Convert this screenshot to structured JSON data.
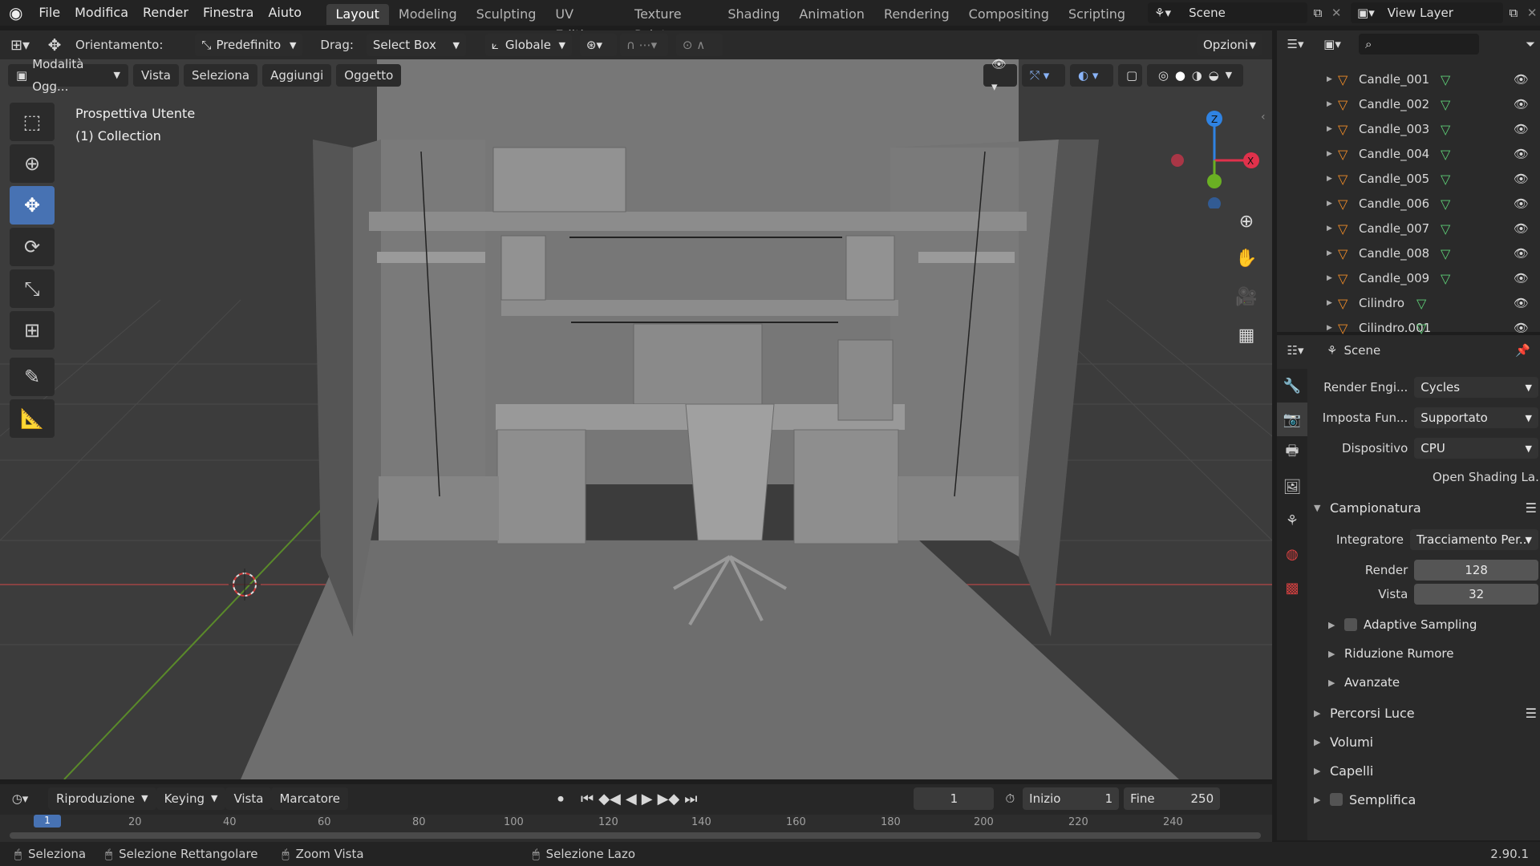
{
  "menu": [
    "File",
    "Modifica",
    "Render",
    "Finestra",
    "Aiuto"
  ],
  "workspaces": [
    "Layout",
    "Modeling",
    "Sculpting",
    "UV Editing",
    "Texture Paint",
    "Shading",
    "Animation",
    "Rendering",
    "Compositing",
    "Scripting"
  ],
  "scene_name": "Scene",
  "view_layer": "View Layer",
  "tool_header": {
    "orient_label": "Orientamento:",
    "orient_value": "Predefinito",
    "drag_label": "Drag:",
    "drag_value": "Select Box",
    "transform": "Globale",
    "options": "Opzioni"
  },
  "viewport_header": {
    "mode": "Modalità Ogg...",
    "view": "Vista",
    "select": "Seleziona",
    "add": "Aggiungi",
    "object": "Oggetto"
  },
  "viewport_info": {
    "perspective": "Prospettiva Utente",
    "collection": "(1) Collection"
  },
  "outliner": [
    "Candle_001",
    "Candle_002",
    "Candle_003",
    "Candle_004",
    "Candle_005",
    "Candle_006",
    "Candle_007",
    "Candle_008",
    "Candle_009",
    "Cilindro",
    "Cilindro.001"
  ],
  "properties": {
    "scene_title": "Scene",
    "render_engine_label": "Render Engi...",
    "render_engine": "Cycles",
    "feature_set_label": "Imposta Fun...",
    "feature_set": "Supportato",
    "device_label": "Dispositivo",
    "device": "CPU",
    "osl": "Open Shading La...",
    "sampling": "Campionatura",
    "integrator_label": "Integratore",
    "integrator": "Tracciamento Per...",
    "render_label": "Render",
    "render_value": "128",
    "viewport_label": "Vista",
    "viewport_value": "32",
    "adaptive": "Adaptive Sampling",
    "denoise": "Riduzione Rumore",
    "advanced": "Avanzate",
    "light_paths": "Percorsi Luce",
    "volumes": "Volumi",
    "hair": "Capelli",
    "simplify": "Semplifica"
  },
  "timeline": {
    "playback": "Riproduzione",
    "keying": "Keying",
    "view": "Vista",
    "marker": "Marcatore",
    "current_frame": "1",
    "start_label": "Inizio",
    "start": "1",
    "end_label": "Fine",
    "end": "250",
    "ticks": [
      "1",
      "20",
      "40",
      "60",
      "80",
      "100",
      "120",
      "140",
      "160",
      "180",
      "200",
      "220",
      "240"
    ]
  },
  "status": {
    "select": "Seleziona",
    "box": "Selezione Rettangolare",
    "zoom": "Zoom Vista",
    "lasso": "Selezione Lazo",
    "version": "2.90.1"
  },
  "colors": {
    "accent": "#4772b3",
    "x_axis": "#e0314b",
    "y_axis": "#6ab023",
    "z_axis": "#2f83e3"
  }
}
